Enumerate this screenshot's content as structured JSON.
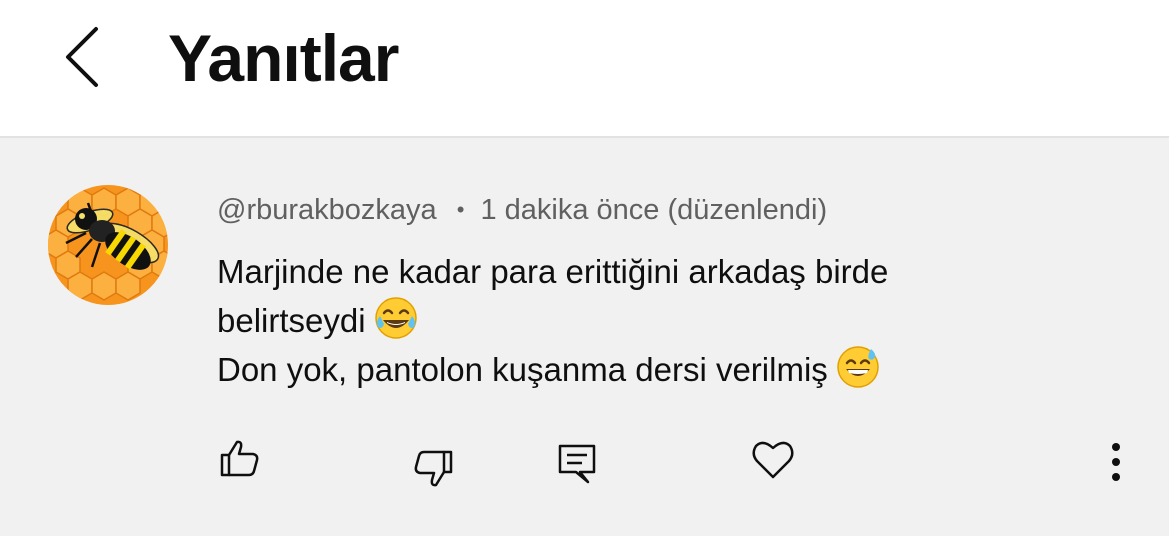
{
  "header": {
    "title": "Yanıtlar",
    "back_icon": "chevron-left-icon"
  },
  "comment": {
    "author": "@rburakbozkaya",
    "separator": "•",
    "time": "1 dakika önce",
    "edited": "(düzenlendi)",
    "lines": [
      "Marjinde ne kadar para erittiğini arkadaş birde",
      "belirtseydi",
      "Don yok, pantolon kuşanma dersi verilmiş"
    ],
    "emojis": [
      "face-with-tears-of-joy",
      "grinning-face-with-sweat"
    ],
    "avatar": "bee-on-honeycomb"
  },
  "actions": {
    "like_icon": "thumbs-up-icon",
    "dislike_icon": "thumbs-down-icon",
    "reply_icon": "comment-icon",
    "heart_icon": "heart-icon",
    "more_icon": "more-vertical-icon"
  },
  "colors": {
    "background": "#ffffff",
    "comment_background": "#f1f1f1",
    "title_text": "#0f0f0f",
    "meta_text": "#606060",
    "avatar_orange": "#f7941d"
  }
}
